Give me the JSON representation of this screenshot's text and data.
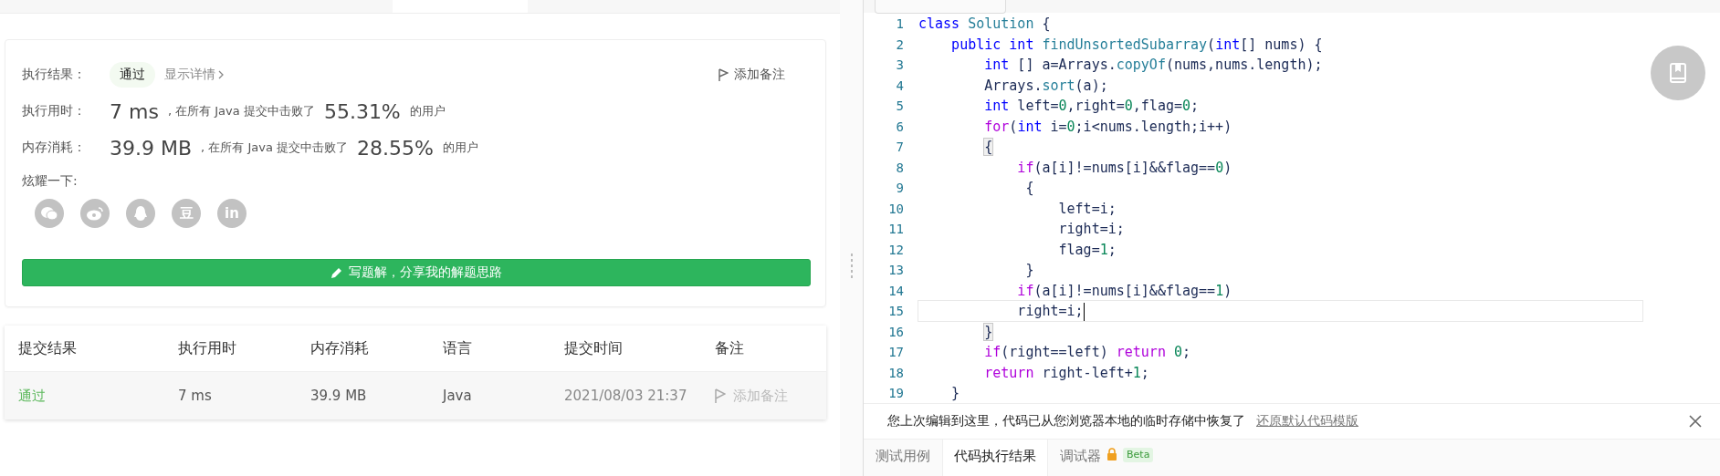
{
  "result": {
    "label": "执行结果：",
    "status": "通过",
    "details_link": "显示详情",
    "note_button": "添加备注"
  },
  "stats": [
    {
      "label": "执行用时：",
      "value": "7 ms",
      "text": ", 在所有 Java 提交中击败了",
      "percent": "55.31%",
      "suffix": "的用户"
    },
    {
      "label": "内存消耗：",
      "value": "39.9 MB",
      "text": ", 在所有 Java 提交中击败了",
      "percent": "28.55%",
      "suffix": "的用户"
    }
  ],
  "share": {
    "label": "炫耀一下:",
    "icons": [
      {
        "kind": "wechat"
      },
      {
        "kind": "weibo"
      },
      {
        "kind": "qq"
      },
      {
        "kind": "douban",
        "glyph": "豆"
      },
      {
        "kind": "linkedin",
        "glyph": "in"
      }
    ]
  },
  "solution_button": "写题解，分享我的解题思路",
  "submissions": {
    "columns": [
      "提交结果",
      "执行用时",
      "内存消耗",
      "语言",
      "提交时间",
      "备注"
    ],
    "rows": [
      {
        "status": "通过",
        "time": "7 ms",
        "memory": "39.9 MB",
        "language": "Java",
        "submitted": "2021/08/03 21:37",
        "note": "添加备注"
      }
    ]
  },
  "editor": {
    "lines": [
      {
        "number": "1",
        "active": false,
        "tokens": [
          {
            "kind": "kw",
            "text": "class"
          },
          {
            "kind": "type",
            "text": " Solution"
          },
          {
            "kind": "plain",
            "text": " {"
          }
        ]
      },
      {
        "number": "2",
        "active": false,
        "tokens": [
          {
            "kind": "kw",
            "text": "    public int"
          },
          {
            "kind": "fn",
            "text": " findUnsortedSubarray"
          },
          {
            "kind": "plain",
            "text": "("
          },
          {
            "kind": "kw",
            "text": "int"
          },
          {
            "kind": "plain",
            "text": "[] nums) {"
          }
        ]
      },
      {
        "number": "3",
        "active": false,
        "tokens": [
          {
            "kind": "kw",
            "text": "        int"
          },
          {
            "kind": "plain",
            "text": " [] a=Arrays."
          },
          {
            "kind": "fn",
            "text": "copyOf"
          },
          {
            "kind": "plain",
            "text": "(nums,nums.length);"
          }
        ]
      },
      {
        "number": "4",
        "active": false,
        "tokens": [
          {
            "kind": "plain",
            "text": "        Arrays."
          },
          {
            "kind": "fn",
            "text": "sort"
          },
          {
            "kind": "plain",
            "text": "(a);"
          }
        ]
      },
      {
        "number": "5",
        "active": false,
        "tokens": [
          {
            "kind": "kw",
            "text": "        int"
          },
          {
            "kind": "plain",
            "text": " left="
          },
          {
            "kind": "num",
            "text": "0"
          },
          {
            "kind": "plain",
            "text": ",right="
          },
          {
            "kind": "num",
            "text": "0"
          },
          {
            "kind": "plain",
            "text": ",flag="
          },
          {
            "kind": "num",
            "text": "0"
          },
          {
            "kind": "plain",
            "text": ";"
          }
        ]
      },
      {
        "number": "6",
        "active": false,
        "tokens": [
          {
            "kind": "ctrl",
            "text": "        for"
          },
          {
            "kind": "plain",
            "text": "("
          },
          {
            "kind": "kw",
            "text": "int"
          },
          {
            "kind": "plain",
            "text": " i="
          },
          {
            "kind": "num",
            "text": "0"
          },
          {
            "kind": "plain",
            "text": ";i<nums.length;i++)"
          }
        ]
      },
      {
        "number": "7",
        "active": false,
        "tokens": [
          {
            "kind": "plain",
            "text": "        {",
            "bracket_match": true
          }
        ]
      },
      {
        "number": "8",
        "active": false,
        "tokens": [
          {
            "kind": "ctrl",
            "text": "            if"
          },
          {
            "kind": "plain",
            "text": "(a[i]!=nums[i]&&flag=="
          },
          {
            "kind": "num",
            "text": "0"
          },
          {
            "kind": "plain",
            "text": ")"
          }
        ]
      },
      {
        "number": "9",
        "active": false,
        "tokens": [
          {
            "kind": "plain",
            "text": "             {"
          }
        ]
      },
      {
        "number": "10",
        "active": false,
        "tokens": [
          {
            "kind": "plain",
            "text": "                 left=i;"
          }
        ]
      },
      {
        "number": "11",
        "active": false,
        "tokens": [
          {
            "kind": "plain",
            "text": "                 right=i;"
          }
        ]
      },
      {
        "number": "12",
        "active": false,
        "tokens": [
          {
            "kind": "plain",
            "text": "                 flag="
          },
          {
            "kind": "num",
            "text": "1"
          },
          {
            "kind": "plain",
            "text": ";"
          }
        ]
      },
      {
        "number": "13",
        "active": false,
        "tokens": [
          {
            "kind": "plain",
            "text": "             }"
          }
        ]
      },
      {
        "number": "14",
        "active": false,
        "tokens": [
          {
            "kind": "ctrl",
            "text": "            if"
          },
          {
            "kind": "plain",
            "text": "(a[i]!=nums[i]&&flag=="
          },
          {
            "kind": "num",
            "text": "1"
          },
          {
            "kind": "plain",
            "text": ")"
          }
        ]
      },
      {
        "number": "15",
        "active": true,
        "tokens": [
          {
            "kind": "plain",
            "text": "            right=i;"
          }
        ]
      },
      {
        "number": "16",
        "active": false,
        "tokens": [
          {
            "kind": "plain",
            "text": "        }",
            "bracket_match": true
          }
        ]
      },
      {
        "number": "17",
        "active": false,
        "tokens": [
          {
            "kind": "ctrl",
            "text": "        if"
          },
          {
            "kind": "plain",
            "text": "(right==left)"
          },
          {
            "kind": "ctrl",
            "text": " return"
          },
          {
            "kind": "num",
            "text": " 0"
          },
          {
            "kind": "plain",
            "text": ";"
          }
        ]
      },
      {
        "number": "18",
        "active": false,
        "tokens": [
          {
            "kind": "ctrl",
            "text": "        return"
          },
          {
            "kind": "plain",
            "text": " right-left+"
          },
          {
            "kind": "num",
            "text": "1"
          },
          {
            "kind": "plain",
            "text": ";"
          }
        ]
      },
      {
        "number": "19",
        "active": false,
        "tokens": [
          {
            "kind": "plain",
            "text": "    }"
          }
        ]
      }
    ]
  },
  "restore_notice": {
    "text": "您上次编辑到这里，代码已从您浏览器本地的临时存储中恢复了",
    "link": "还原默认代码模版"
  },
  "bottom_tabs": [
    {
      "label": "测试用例",
      "selected": false
    },
    {
      "label": "代码执行结果",
      "selected": true
    },
    {
      "label": "调试器",
      "selected": false,
      "badge": "Beta"
    }
  ]
}
